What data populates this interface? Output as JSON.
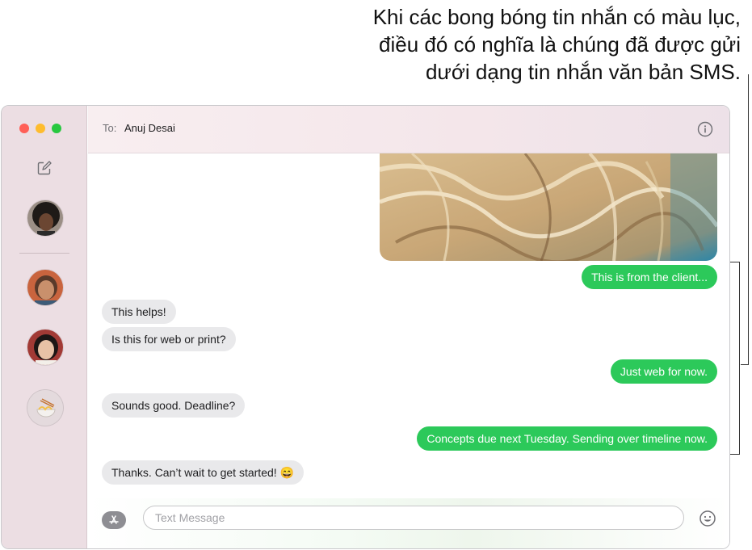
{
  "callout": {
    "lines": [
      "Khi các bong bóng tin nhắn có màu lục,",
      "điều đó có nghĩa là chúng đã được gửi",
      "dưới dạng tin nhắn văn bản SMS."
    ]
  },
  "header": {
    "to_label": "To:",
    "recipient": "Anuj Desai"
  },
  "messages": [
    {
      "direction": "out",
      "text": "This is from the client..."
    },
    {
      "direction": "in",
      "text": "This helps!"
    },
    {
      "direction": "in",
      "text": "Is this for web or print?"
    },
    {
      "direction": "out",
      "text": "Just web for now."
    },
    {
      "direction": "in",
      "text": "Sounds good. Deadline?"
    },
    {
      "direction": "out",
      "text": "Concepts due next Tuesday. Sending over timeline now."
    },
    {
      "direction": "in",
      "text": "Thanks. Can’t wait to get started! 😄"
    }
  ],
  "composer": {
    "placeholder": "Text Message"
  },
  "colors": {
    "sms_bubble": "#2cc95a",
    "received_bubble": "#e9e9eb",
    "sidebar": "#ecdee3"
  },
  "icons": [
    "compose-icon",
    "info-icon",
    "app-store-icon",
    "emoji-icon"
  ]
}
